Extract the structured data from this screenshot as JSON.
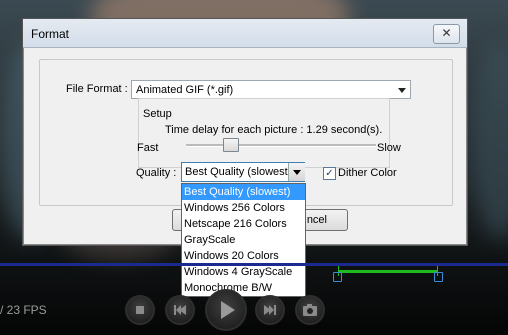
{
  "window": {
    "title": "Format",
    "close_glyph": "✕"
  },
  "file_format": {
    "label": "File Format :",
    "value": "Animated GIF (*.gif)"
  },
  "setup": {
    "title": "Setup",
    "delay_text": "Time delay for each picture : 1.29 second(s).",
    "fast_label": "Fast",
    "slow_label": "Slow",
    "slider_level": 0.25
  },
  "quality": {
    "label": "Quality :",
    "selected": "Best Quality (slowest)",
    "options": [
      "Best Quality (slowest)",
      "Windows 256 Colors",
      "Netscape 216 Colors",
      "GrayScale",
      "Windows 20 Colors",
      "Windows 4 GrayScale",
      "Monochrome B/W"
    ]
  },
  "dither": {
    "label": "Dither Color",
    "checked": true
  },
  "buttons": {
    "ok_visible": "O",
    "cancel_visible": "ncel"
  },
  "player": {
    "fps_text": "/ 23 FPS"
  },
  "colors": {
    "accent": "#3399ff",
    "range": "#1dbb1d",
    "timeline": "#1a2a90"
  }
}
